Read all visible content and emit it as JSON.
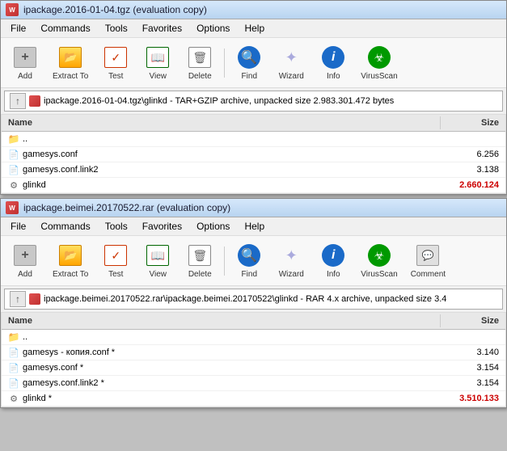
{
  "window1": {
    "title": "ipackage.2016-01-04.tgz (evaluation copy)",
    "menus": [
      "File",
      "Commands",
      "Tools",
      "Favorites",
      "Options",
      "Help"
    ],
    "toolbar": {
      "buttons": [
        {
          "id": "add",
          "label": "Add",
          "icon": "add"
        },
        {
          "id": "extract",
          "label": "Extract To",
          "icon": "extract"
        },
        {
          "id": "test",
          "label": "Test",
          "icon": "test"
        },
        {
          "id": "view",
          "label": "View",
          "icon": "view"
        },
        {
          "id": "delete",
          "label": "Delete",
          "icon": "delete"
        },
        {
          "id": "find",
          "label": "Find",
          "icon": "find"
        },
        {
          "id": "wizard",
          "label": "Wizard",
          "icon": "wizard"
        },
        {
          "id": "info",
          "label": "Info",
          "icon": "info"
        },
        {
          "id": "virusscan",
          "label": "VirusScan",
          "icon": "virusscan"
        }
      ]
    },
    "address": "ipackage.2016-01-04.tgz\\glinkd - TAR+GZIP archive, unpacked size 2.983.301.472 bytes",
    "columns": [
      "Name",
      "Size"
    ],
    "files": [
      {
        "name": "..",
        "type": "parent",
        "size": ""
      },
      {
        "name": "gamesys.conf",
        "type": "conf",
        "size": "6.256",
        "highlighted": false
      },
      {
        "name": "gamesys.conf.link2",
        "type": "conf-link",
        "size": "3.138",
        "highlighted": false
      },
      {
        "name": "glinkd",
        "type": "binary",
        "size": "2.660.124",
        "highlighted": true
      }
    ]
  },
  "window2": {
    "title": "ipackage.beimei.20170522.rar (evaluation copy)",
    "menus": [
      "File",
      "Commands",
      "Tools",
      "Favorites",
      "Options",
      "Help"
    ],
    "toolbar": {
      "buttons": [
        {
          "id": "add",
          "label": "Add",
          "icon": "add"
        },
        {
          "id": "extract",
          "label": "Extract To",
          "icon": "extract"
        },
        {
          "id": "test",
          "label": "Test",
          "icon": "test"
        },
        {
          "id": "view",
          "label": "View",
          "icon": "view"
        },
        {
          "id": "delete",
          "label": "Delete",
          "icon": "delete"
        },
        {
          "id": "find",
          "label": "Find",
          "icon": "find"
        },
        {
          "id": "wizard",
          "label": "Wizard",
          "icon": "wizard"
        },
        {
          "id": "info",
          "label": "Info",
          "icon": "info"
        },
        {
          "id": "virusscan",
          "label": "VirusScan",
          "icon": "virusscan"
        },
        {
          "id": "comment",
          "label": "Comment",
          "icon": "comment"
        }
      ]
    },
    "address": "ipackage.beimei.20170522.rar\\ipackage.beimei.20170522\\glinkd - RAR 4.x archive, unpacked size 3.4",
    "columns": [
      "Name",
      "Size"
    ],
    "files": [
      {
        "name": "..",
        "type": "parent",
        "size": ""
      },
      {
        "name": "gamesys - копия.conf *",
        "type": "conf",
        "size": "3.140",
        "highlighted": false
      },
      {
        "name": "gamesys.conf *",
        "type": "conf",
        "size": "3.154",
        "highlighted": false
      },
      {
        "name": "gamesys.conf.link2 *",
        "type": "conf-link",
        "size": "3.154",
        "highlighted": false
      },
      {
        "name": "glinkd *",
        "type": "binary",
        "size": "3.510.133",
        "highlighted": true
      }
    ]
  }
}
